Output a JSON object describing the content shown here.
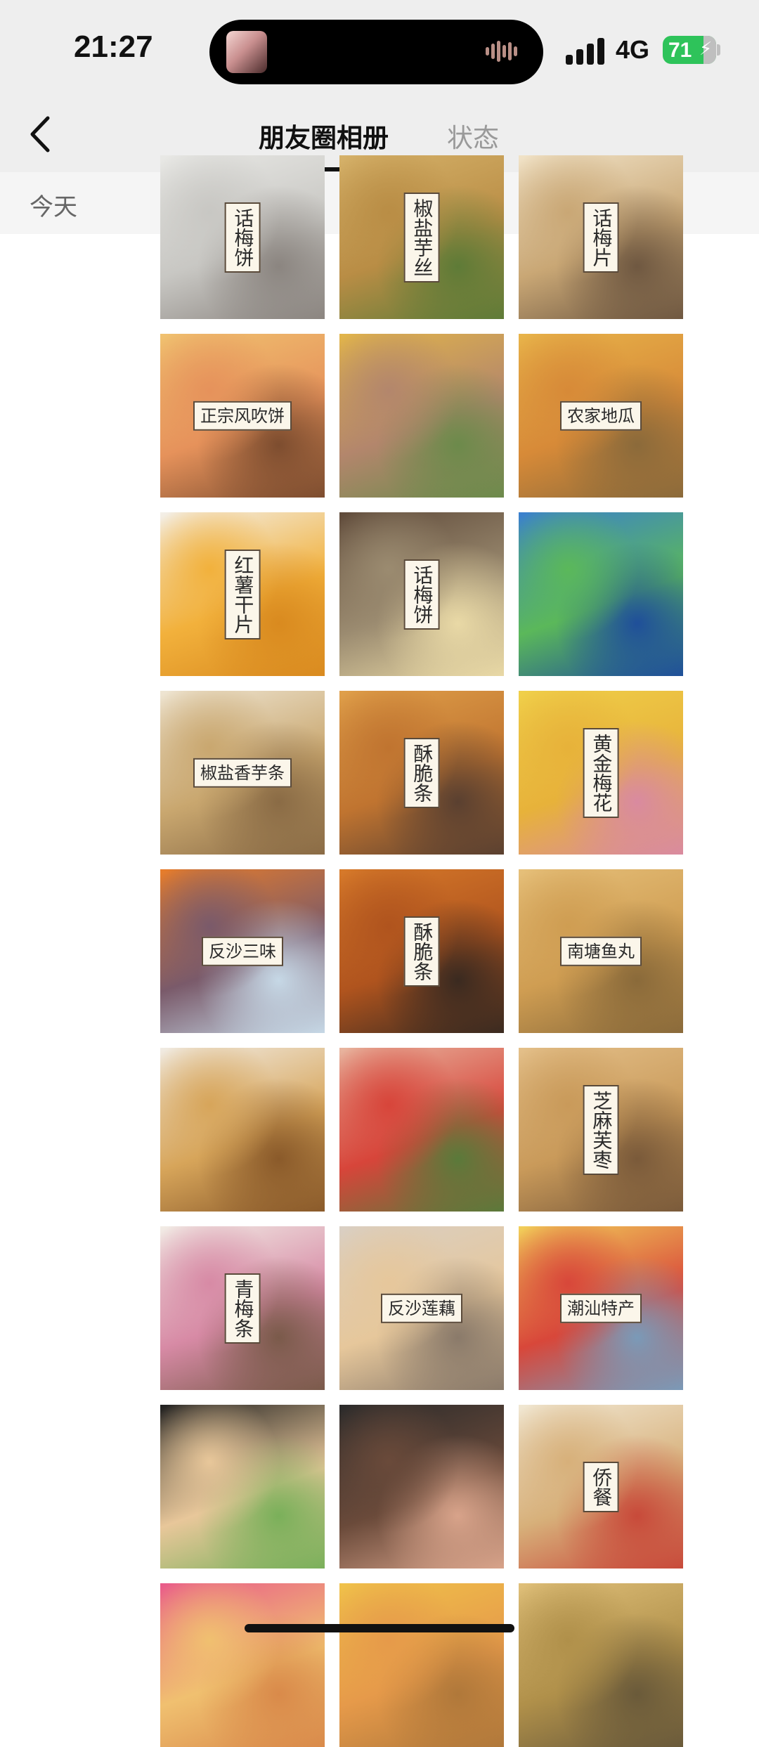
{
  "status_bar": {
    "time": "21:27",
    "network": "4G",
    "battery": "71"
  },
  "nav": {
    "back_icon": "chevron-left-icon",
    "tabs": [
      {
        "label": "朋友圈相册",
        "active": true
      },
      {
        "label": "状态",
        "active": false
      }
    ]
  },
  "section": {
    "label": "今天"
  },
  "colors": {
    "battery": "#2ec35a",
    "background": "#eeeeee",
    "active_tab": "#111111",
    "inactive_tab": "#9a9a9a"
  },
  "photos": [
    {
      "label": "话梅饼",
      "colors": [
        "#e9e9e6",
        "#c8c7c3",
        "#8b8580"
      ]
    },
    {
      "label": "椒盐芋丝",
      "colors": [
        "#d6b26a",
        "#b98d45",
        "#5e7b37"
      ]
    },
    {
      "label": "话梅片",
      "colors": [
        "#f1e3c8",
        "#c9a775",
        "#6f5841"
      ]
    },
    {
      "label": "正宗风吹饼",
      "colors": [
        "#f0c270",
        "#e6925b",
        "#7d4d2f"
      ]
    },
    {
      "label": "",
      "colors": [
        "#e2b54a",
        "#b3866c",
        "#6c8a4b"
      ]
    },
    {
      "label": "农家地瓜",
      "colors": [
        "#e8b44a",
        "#d78a38",
        "#8b6a3a"
      ]
    },
    {
      "label": "红薯干片",
      "colors": [
        "#f3f0ea",
        "#f2b13c",
        "#d98a1f"
      ]
    },
    {
      "label": "话梅饼",
      "colors": [
        "#5f4a3a",
        "#9b8b70",
        "#e9d9a6"
      ]
    },
    {
      "label": "",
      "colors": [
        "#3a7fd0",
        "#5bb85a",
        "#1f4f9a"
      ]
    },
    {
      "label": "椒盐香芋条",
      "colors": [
        "#efe6d4",
        "#c9a76f",
        "#8a6b45"
      ]
    },
    {
      "label": "酥脆条",
      "colors": [
        "#e0a04a",
        "#c07430",
        "#5a4030"
      ]
    },
    {
      "label": "黄金梅花",
      "colors": [
        "#f0d04a",
        "#e7b23a",
        "#d98aa0"
      ]
    },
    {
      "label": "反沙三味",
      "colors": [
        "#e87d2a",
        "#7a5a6a",
        "#c6d8e6"
      ]
    },
    {
      "label": "酥脆条",
      "colors": [
        "#d77a2a",
        "#b0541e",
        "#3a2a20"
      ]
    },
    {
      "label": "南塘鱼丸",
      "colors": [
        "#e6c07a",
        "#cf9d52",
        "#8a6a3a"
      ]
    },
    {
      "label": "",
      "colors": [
        "#f1ece4",
        "#d7a55a",
        "#8a5a2a"
      ]
    },
    {
      "label": "",
      "colors": [
        "#e8b6a0",
        "#d7453a",
        "#5a7a3a"
      ]
    },
    {
      "label": "芝麻芙枣",
      "colors": [
        "#e4c08a",
        "#c99a5a",
        "#7a5a3a"
      ]
    },
    {
      "label": "青梅条",
      "colors": [
        "#f2ede6",
        "#d78aa5",
        "#7a5a4a"
      ]
    },
    {
      "label": "反沙莲藕",
      "colors": [
        "#d9cfc4",
        "#e6c79b",
        "#8a7a6a"
      ]
    },
    {
      "label": "潮汕特产",
      "colors": [
        "#f2d05a",
        "#d8473a",
        "#7a9ab8"
      ]
    },
    {
      "label": "",
      "colors": [
        "#1f1f1f",
        "#e8c79a",
        "#7ab05a"
      ]
    },
    {
      "label": "",
      "colors": [
        "#2a2a2a",
        "#6a4a3a",
        "#d8a38a"
      ]
    },
    {
      "label": "侨餐",
      "colors": [
        "#f1e8d4",
        "#d7b07a",
        "#c84a3a"
      ]
    },
    {
      "label": "",
      "colors": [
        "#e95a8a",
        "#f0c070",
        "#d98a4a"
      ]
    },
    {
      "label": "",
      "colors": [
        "#f0c24a",
        "#e69a4a",
        "#b0783a"
      ]
    },
    {
      "label": "",
      "colors": [
        "#e0c07a",
        "#b0904a",
        "#6a5a3a"
      ]
    }
  ]
}
